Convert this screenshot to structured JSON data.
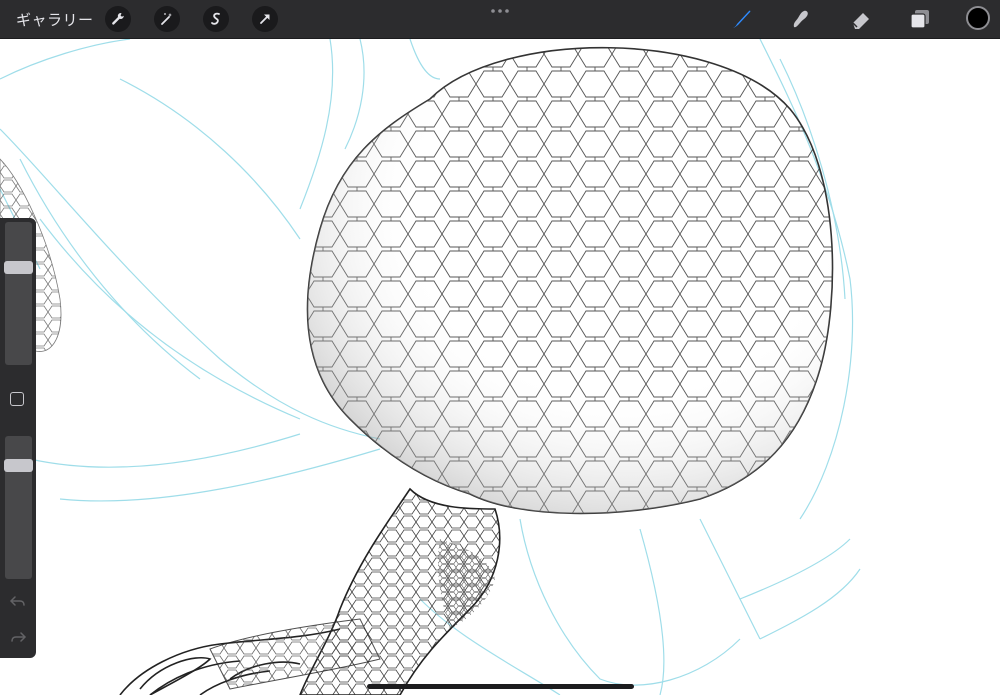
{
  "toolbar": {
    "gallery_label": "ギャラリー",
    "left_tools": [
      "wrench-icon",
      "magic-wand-icon",
      "selection-icon",
      "transform-arrow-icon"
    ],
    "right_tools": [
      "brush-icon",
      "smudge-icon",
      "eraser-icon",
      "layers-icon"
    ],
    "active_tool": "brush-icon",
    "accent_color": "#2e8bff",
    "current_color": "#000000"
  },
  "sidebar": {
    "brush_size_level": 0.3,
    "opacity_level": 0.18
  },
  "canvas": {
    "sketch_color": "#8fd8e6",
    "ink_color": "#1a1a1a"
  }
}
